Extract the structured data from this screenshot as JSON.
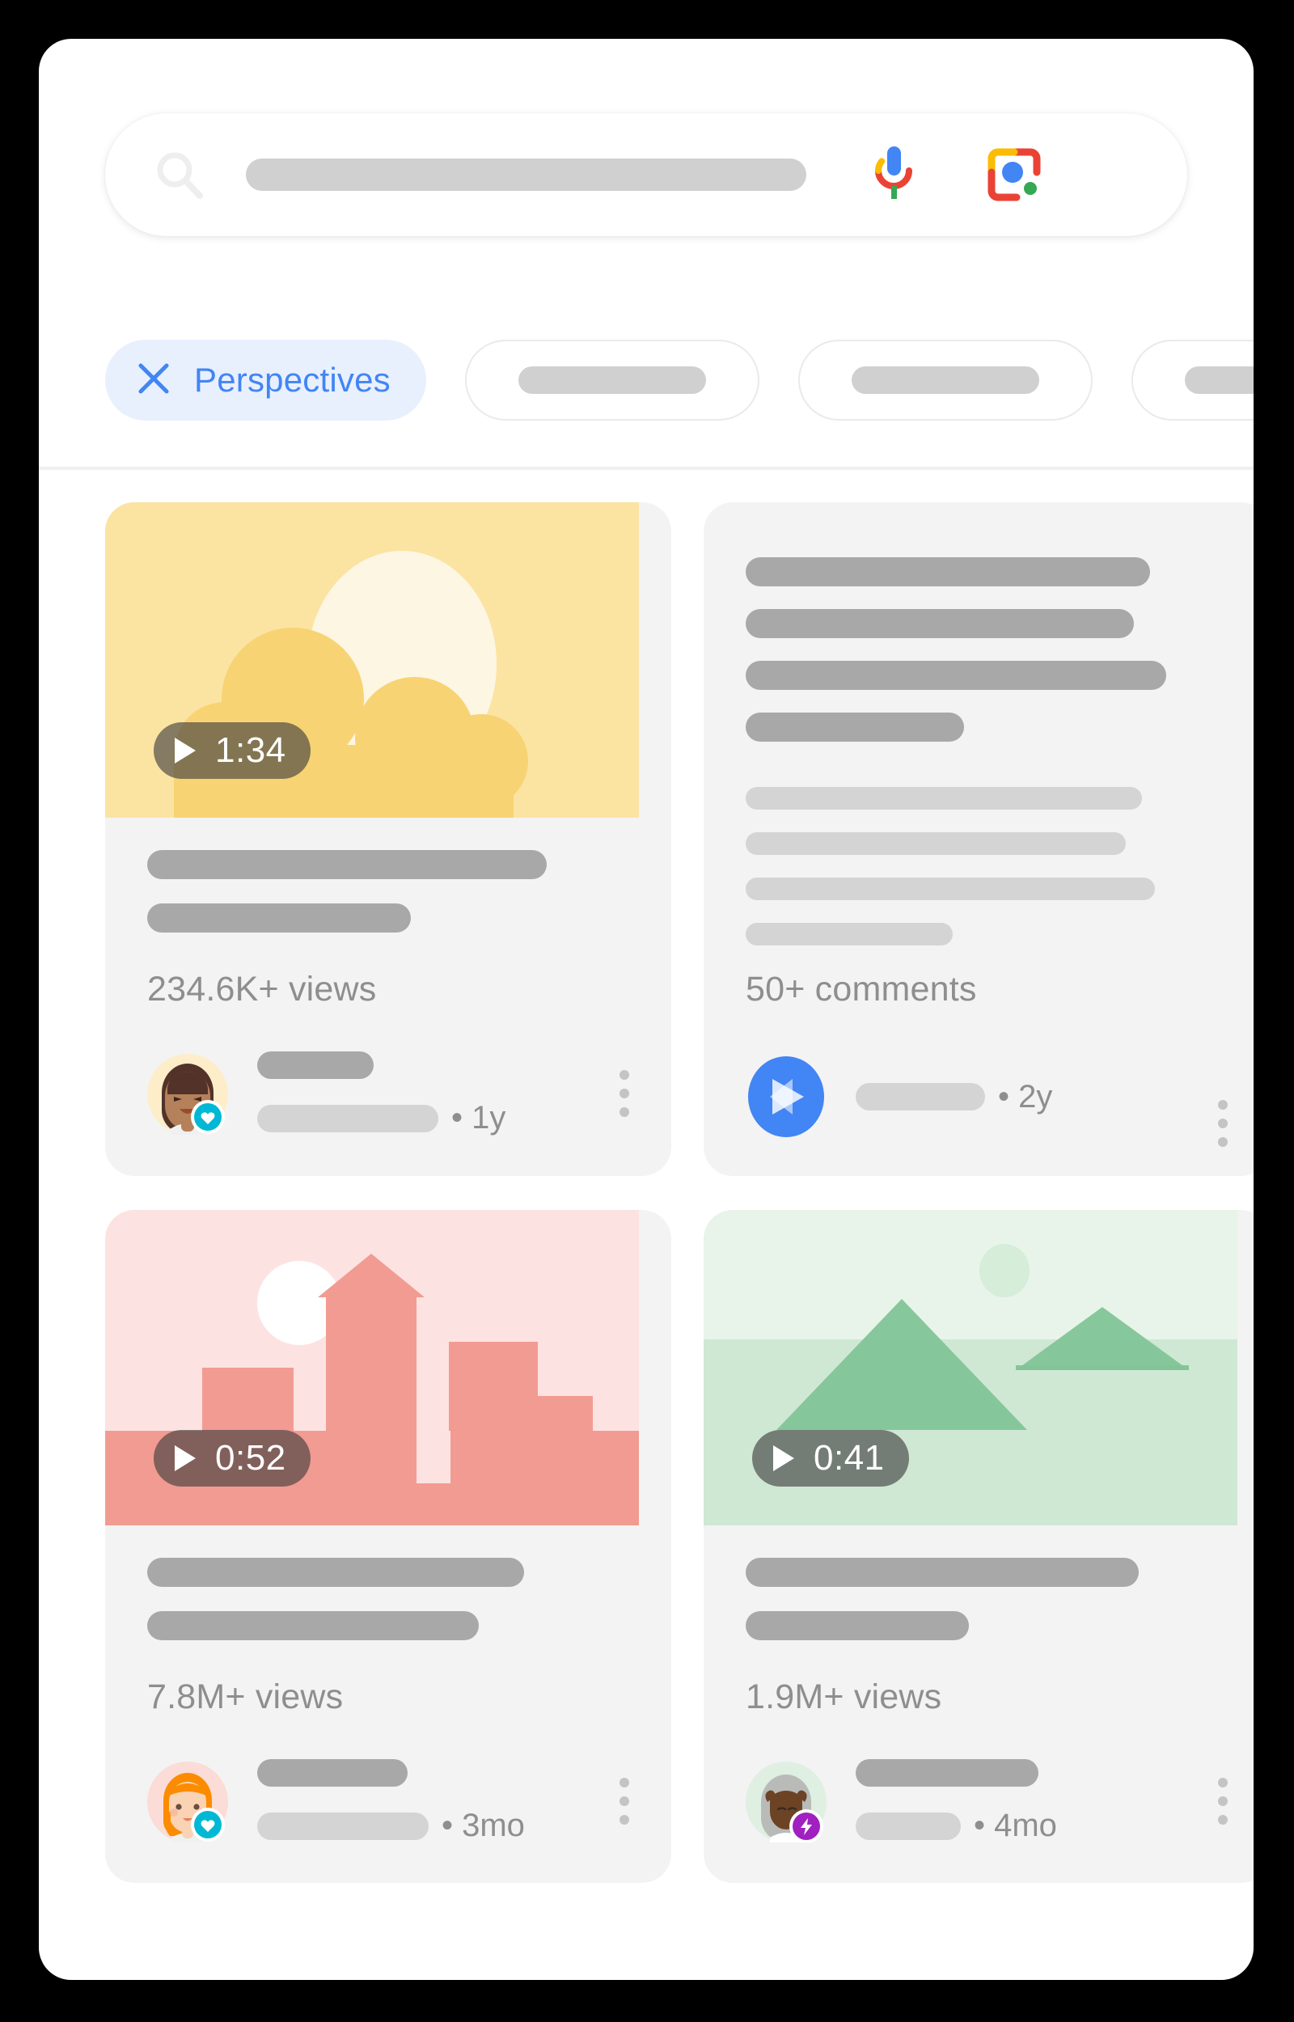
{
  "search": {
    "search_icon": "search-icon",
    "placeholder": "",
    "mic_icon": "microphone-icon",
    "lens_icon": "google-lens-icon"
  },
  "filters": {
    "active_chip": {
      "label": "Perspectives",
      "close_icon": "close-icon",
      "color": "#4285f4",
      "bg": "#e8f0fe"
    },
    "ghost_chips": [
      {
        "label": ""
      },
      {
        "label": ""
      },
      {
        "label": ""
      }
    ]
  },
  "results": [
    {
      "id": "card-video-clouds",
      "kind": "video",
      "thumb_theme": "clouds-sun",
      "duration": "1:34",
      "play_icon": "play-icon",
      "views": "234.6K+ views",
      "avatar": "woman-avatar",
      "badge": "heart-verified-badge",
      "age": "• 1y",
      "more_icon": "kebab-menu-icon"
    },
    {
      "id": "card-text-comments",
      "kind": "text",
      "comments": "50+ comments",
      "source_icon": "blue-play-badge-icon",
      "age": "• 2y",
      "more_icon": "kebab-menu-icon"
    },
    {
      "id": "card-video-city",
      "kind": "video",
      "thumb_theme": "city-skyline",
      "duration": "0:52",
      "play_icon": "play-icon",
      "views": "7.8M+ views",
      "avatar": "orange-hair-avatar",
      "badge": "heart-verified-badge",
      "age": "• 3mo",
      "more_icon": "kebab-menu-icon"
    },
    {
      "id": "card-video-mountains",
      "kind": "video",
      "thumb_theme": "mountains-sun",
      "duration": "0:41",
      "play_icon": "play-icon",
      "views": "1.9M+ views",
      "avatar": "elder-avatar",
      "badge": "bolt-badge",
      "age": "• 4mo",
      "more_icon": "kebab-menu-icon"
    }
  ],
  "palette": {
    "page_bg": "#000000",
    "panel_bg": "#ffffff",
    "card_bg": "#f3f3f3",
    "skeleton_dark": "#a8a8a8",
    "skeleton_light": "#d4d4d4",
    "muted_text": "#8e8e8e",
    "accent_blue": "#4285f4",
    "thumb_yellow": "#fbe3a2",
    "thumb_pink": "#fce3e1",
    "thumb_green": "#e8f4e9",
    "badge_cyan": "#00b8d4",
    "badge_purple": "#a020c0"
  }
}
